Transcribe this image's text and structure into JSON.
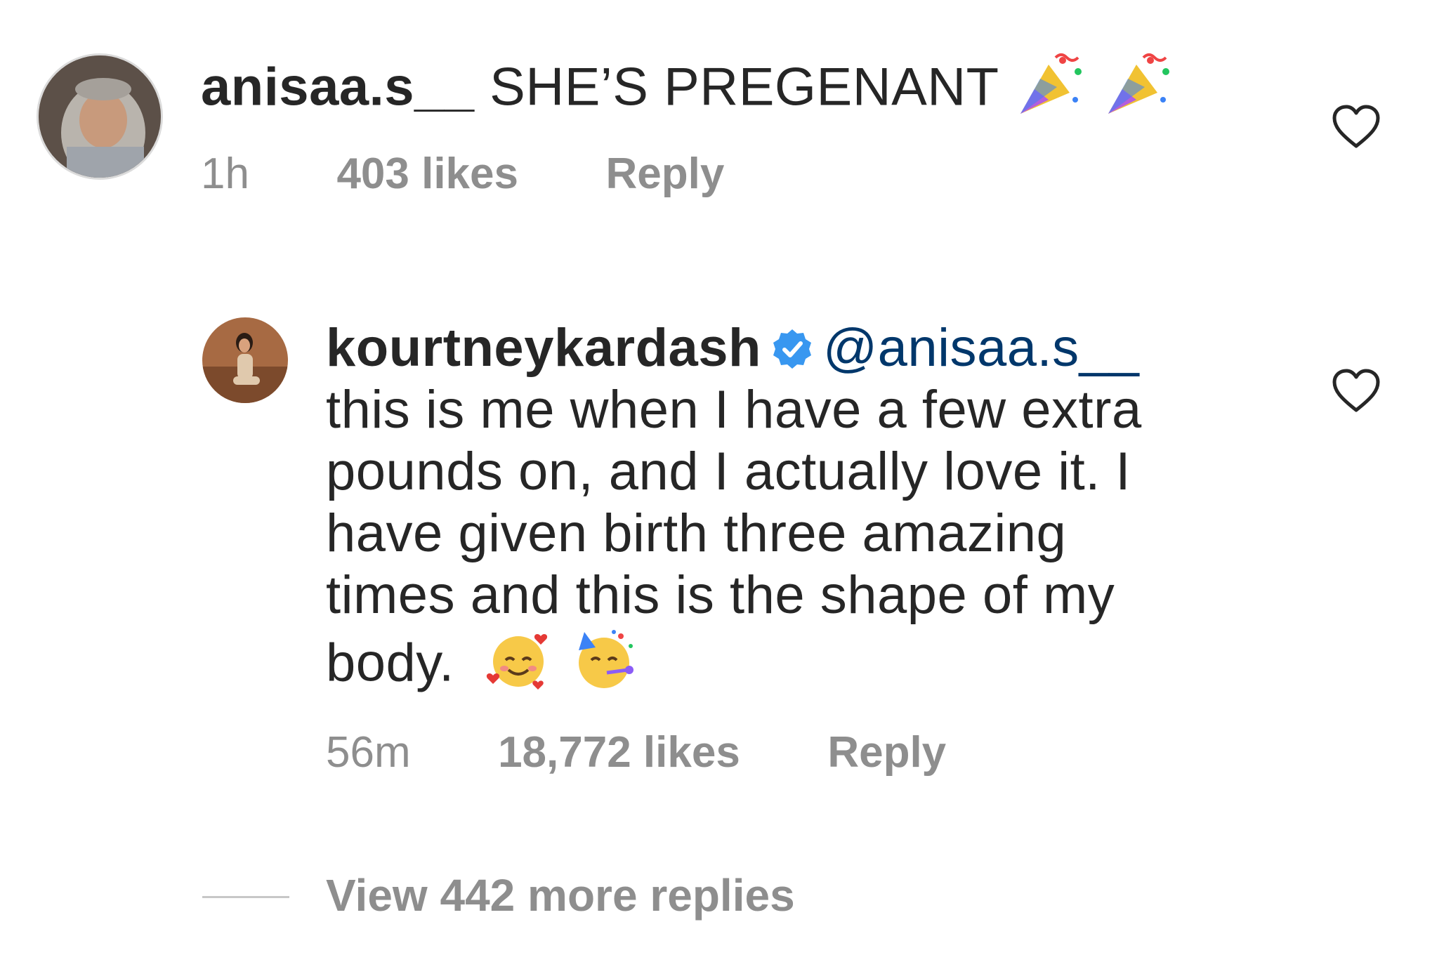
{
  "comments": [
    {
      "username": "anisaa.s__",
      "text": "SHE’S PREGENANT",
      "emoji": [
        "party-popper",
        "party-popper"
      ],
      "time": "1h",
      "likes": "403 likes",
      "reply_label": "Reply",
      "verified": false
    },
    {
      "username": "kourtneykardash",
      "verified": true,
      "mention": "@anisaa.s__",
      "text_lines": [
        "this is me when I have a few extra",
        "pounds on, and I actually love it.  I",
        "have given birth three amazing",
        "times and this is the shape of my",
        "body."
      ],
      "emoji": [
        "smiling-face-with-hearts",
        "partying-face"
      ],
      "time": "56m",
      "likes": "18,772 likes",
      "reply_label": "Reply"
    }
  ],
  "view_more_replies": "View 442 more replies",
  "colors": {
    "text": "#262626",
    "secondary": "#8e8e8e",
    "mention": "#00376b",
    "verified_blue": "#3897f0"
  },
  "icons": [
    "heart-outline-icon",
    "verified-badge-icon"
  ]
}
